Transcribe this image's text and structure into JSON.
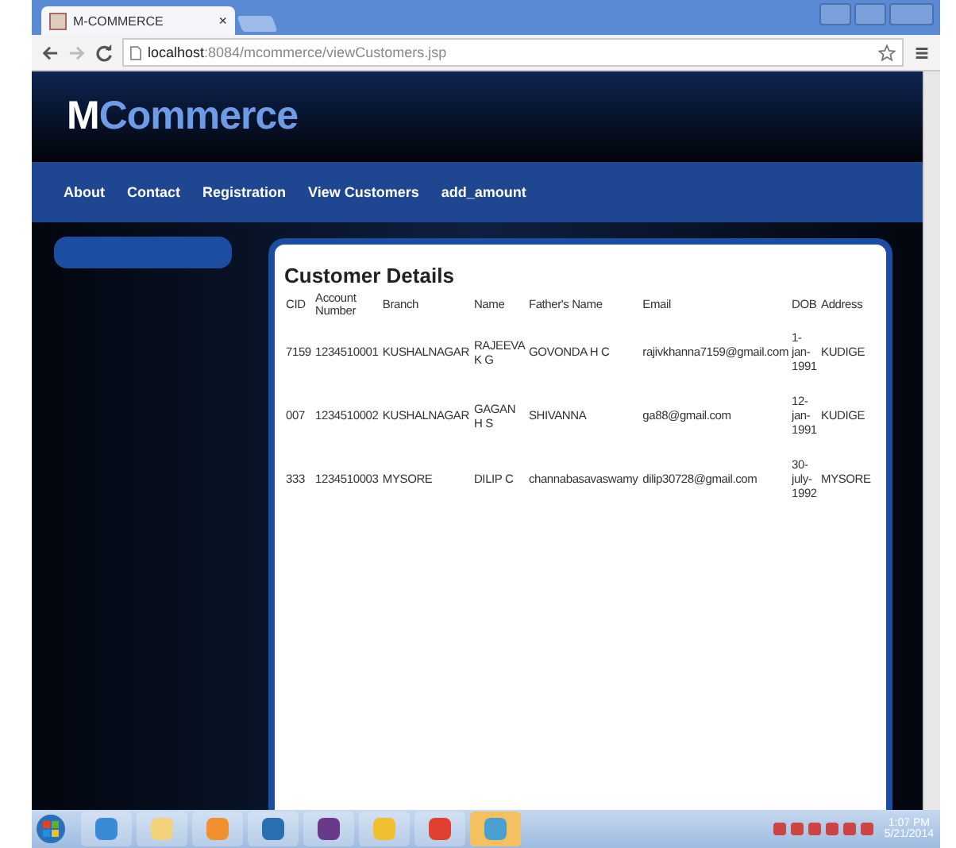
{
  "browser": {
    "tab_title": "M-COMMERCE",
    "tab_close": "×",
    "url_host": "localhost",
    "url_path": ":8084/mcommerce/viewCustomers.jsp"
  },
  "site": {
    "logo_first": "M",
    "logo_rest": "Commerce",
    "nav": [
      "About",
      "Contact",
      "Registration",
      "View Customers",
      "add_amount"
    ]
  },
  "panel": {
    "title": "Customer Details",
    "columns": [
      "CID",
      "Account Number",
      "Branch",
      "Name",
      "Father's Name",
      "Email",
      "DOB",
      "Address"
    ],
    "rows": [
      [
        "7159",
        "1234510001",
        "KUSHALNAGAR",
        "RAJEEVA K G",
        "GOVONDA H C",
        "rajivkhanna7159@gmail.com",
        "1-jan-1991",
        "KUDIGE"
      ],
      [
        "007",
        "1234510002",
        "KUSHALNAGAR",
        "GAGAN H S",
        "SHIVANNA",
        "ga88@gmail.com",
        "12-jan-1991",
        "KUDIGE"
      ],
      [
        "333",
        "1234510003",
        "MYSORE",
        "DILIP C",
        "channabasavaswamy",
        "dilip30728@gmail.com",
        "30-july-1992",
        "MYSORE"
      ]
    ]
  },
  "taskbar": {
    "time": "1:07 PM",
    "date": "5/21/2014"
  }
}
